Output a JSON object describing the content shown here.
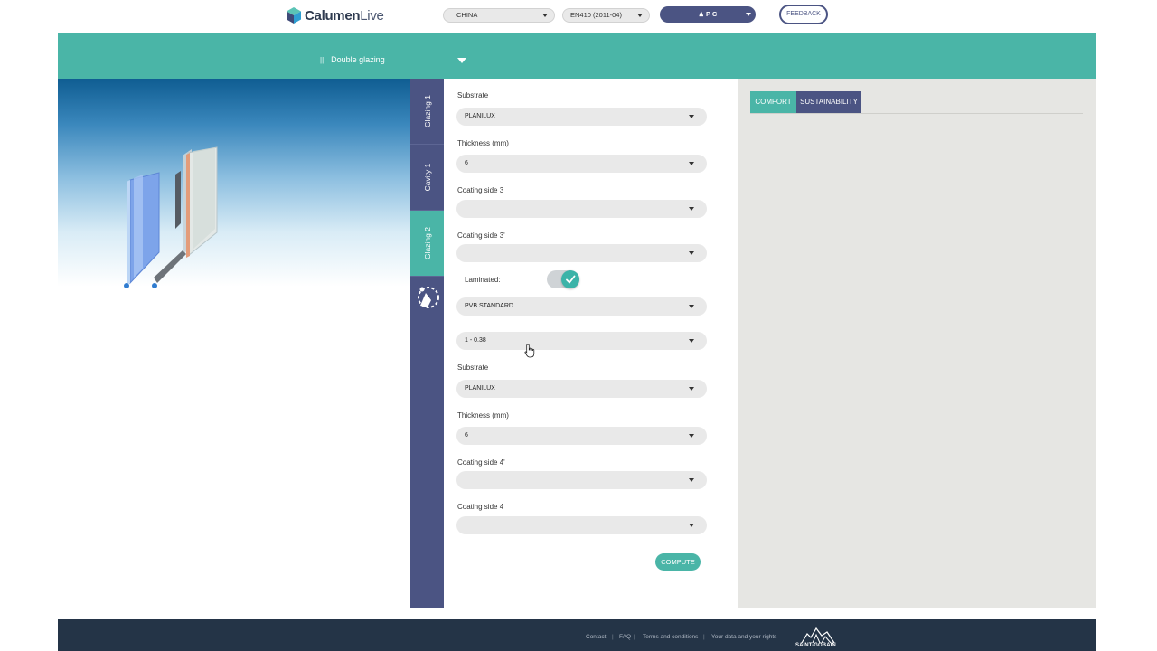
{
  "header": {
    "logo_brand": "Calumen",
    "logo_suffix": "Live",
    "country": "CHINA",
    "standard": "EN410 (2011-04)",
    "user_initials": "P C",
    "feedback_label": "FEEDBACK"
  },
  "glazing_selector": {
    "label": "Double glazing"
  },
  "vertical_tabs": [
    {
      "label": "Glazing 1",
      "active": false
    },
    {
      "label": "Cavity 1",
      "active": false
    },
    {
      "label": "Glazing 2",
      "active": true
    }
  ],
  "form": {
    "substrate_label": "Substrate",
    "substrate_value": "PLANILUX",
    "thickness_label": "Thickness (mm)",
    "thickness_value": "6",
    "coating3_label": "Coating side 3",
    "coating3_value": "",
    "coating3p_label": "Coating side 3'",
    "coating3p_value": "",
    "laminated_label": "Laminated:",
    "laminated_on": true,
    "interlayer_value": "PVB STANDARD",
    "interlayer_thickness_value": "1 - 0.38",
    "substrate2_label": "Substrate",
    "substrate2_value": "PLANILUX",
    "thickness2_label": "Thickness (mm)",
    "thickness2_value": "6",
    "coating4p_label": "Coating side 4'",
    "coating4p_value": "",
    "coating4_label": "Coating side 4",
    "coating4_value": "",
    "compute_label": "COMPUTE"
  },
  "results": {
    "tab_comfort": "COMFORT",
    "tab_sustainability": "SUSTAINABILITY"
  },
  "footer": {
    "links": [
      "Contact",
      "FAQ",
      "Terms and conditions",
      "Your data and your rights"
    ],
    "separator": "|",
    "brand": "SAINT-GOBAIN"
  },
  "colors": {
    "teal": "#4ab5a7",
    "navy": "#4b5483",
    "footer_bg": "#243447",
    "panel_bg": "#e6e6e3"
  }
}
